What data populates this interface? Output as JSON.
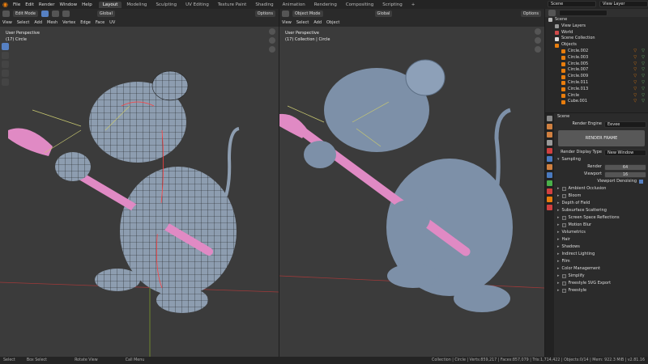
{
  "menus": [
    "File",
    "Edit",
    "Render",
    "Window",
    "Help"
  ],
  "workspaces": [
    "Layout",
    "Modeling",
    "Sculpting",
    "UV Editing",
    "Texture Paint",
    "Shading",
    "Animation",
    "Rendering",
    "Compositing",
    "Scripting",
    "+"
  ],
  "scene": "Scene",
  "view_layer": "View Layer",
  "left_vp": {
    "mode": "Edit Mode",
    "orientation": "Global",
    "menus": [
      "View",
      "Select",
      "Add",
      "Mesh",
      "Vertex",
      "Edge",
      "Face",
      "UV"
    ],
    "options": "Options",
    "info1": "User Perspective",
    "info2": "(17) Circle"
  },
  "right_vp": {
    "mode": "Object Mode",
    "orientation": "Global",
    "menus": [
      "View",
      "Select",
      "Add",
      "Object"
    ],
    "options": "Options",
    "info1": "User Perspective",
    "info2": "(17) Collection | Circle"
  },
  "outliner": {
    "rows": [
      {
        "label": "Scene",
        "color": "#bbbbbb",
        "indent": 0
      },
      {
        "label": "View Layers",
        "color": "#999999",
        "indent": 1
      },
      {
        "label": "World",
        "color": "#d04a4a",
        "indent": 1
      },
      {
        "label": "Scene Collection",
        "color": "#dddddd",
        "indent": 1
      },
      {
        "label": "Objects",
        "color": "#e87d0d",
        "indent": 1
      },
      {
        "label": "Circle.002",
        "color": "#e87d0d",
        "indent": 2
      },
      {
        "label": "Circle.003",
        "color": "#e87d0d",
        "indent": 2
      },
      {
        "label": "Circle.005",
        "color": "#e87d0d",
        "indent": 2
      },
      {
        "label": "Circle.007",
        "color": "#e87d0d",
        "indent": 2
      },
      {
        "label": "Circle.009",
        "color": "#e87d0d",
        "indent": 2
      },
      {
        "label": "Circle.011",
        "color": "#e87d0d",
        "indent": 2
      },
      {
        "label": "Circle.013",
        "color": "#e87d0d",
        "indent": 2
      },
      {
        "label": "Circle",
        "color": "#e87d0d",
        "indent": 2
      },
      {
        "label": "Cube.001",
        "color": "#e87d0d",
        "indent": 2
      }
    ]
  },
  "properties": {
    "scene_label": "Scene",
    "render_engine_label": "Render Engine",
    "render_engine": "Eevee",
    "render_frame": "RENDER FRAME",
    "display_type_label": "Render Display Type",
    "display_type": "New Window",
    "sampling": "Sampling",
    "render_label": "Render",
    "render_value": "64",
    "viewport_label": "Viewport",
    "viewport_value": "16",
    "viewport_denoising": "Viewport Denoising",
    "panels": [
      {
        "label": "Ambient Occlusion",
        "cb": true
      },
      {
        "label": "Bloom",
        "cb": true
      },
      {
        "label": "Depth of Field",
        "cb": false
      },
      {
        "label": "Subsurface Scattering",
        "cb": false
      },
      {
        "label": "Screen Space Reflections",
        "cb": true
      },
      {
        "label": "Motion Blur",
        "cb": true
      },
      {
        "label": "Volumetrics",
        "cb": false
      },
      {
        "label": "Hair",
        "cb": false
      },
      {
        "label": "Shadows",
        "cb": false
      },
      {
        "label": "Indirect Lighting",
        "cb": false
      },
      {
        "label": "Film",
        "cb": false
      },
      {
        "label": "Color Management",
        "cb": false
      },
      {
        "label": "Simplify",
        "cb": true
      },
      {
        "label": "Freestyle SVG Export",
        "cb": true
      },
      {
        "label": "Freestyle",
        "cb": true
      }
    ]
  },
  "status": {
    "select": "Select",
    "box_select": "Box Select",
    "rotate_view": "Rotate View",
    "call_menu": "Call Menu",
    "stats": "Collection | Circle | Verts:859,217 | Faces:857,079 | Tris:1,714,422 | Objects:0/14 | Mem: 922.3 MiB | v2.81.16"
  },
  "colors": {
    "accent": "#e87d0d",
    "mesh": "#8d9db0",
    "brush": "#e08ac4",
    "select": "#5680c2"
  }
}
